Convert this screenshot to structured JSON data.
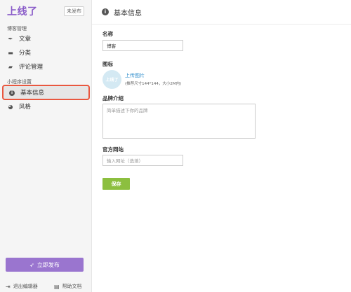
{
  "sidebar": {
    "brand": "上线了",
    "status_badge": "未发布",
    "groups": [
      {
        "title": "博客管理",
        "items": [
          {
            "label": "文章",
            "icon": "pen-icon"
          },
          {
            "label": "分类",
            "icon": "folder-icon"
          },
          {
            "label": "评论管理",
            "icon": "comment-icon"
          }
        ]
      },
      {
        "title": "小程序设置",
        "items": [
          {
            "label": "基本信息",
            "icon": "info-icon",
            "active": true
          },
          {
            "label": "风格",
            "icon": "palette-icon"
          }
        ]
      }
    ],
    "publish_button": "立即发布",
    "footer": {
      "exit_editor": "退出编辑器",
      "help_docs": "帮助文档"
    }
  },
  "main": {
    "title": "基本信息",
    "name_label": "名称",
    "name_value": "博客",
    "icon_label": "图标",
    "logo_text": "上线了",
    "upload_link": "上传图片",
    "upload_hint": "(推荐尺寸144*144，大小2M内)",
    "brand_intro_label": "品牌介绍",
    "brand_intro_placeholder": "简单描述下你的品牌",
    "website_label": "官方网站",
    "website_placeholder": "输入网址（选填）",
    "save_button": "保存"
  },
  "colors": {
    "brand": "#8a5cc9",
    "publish_button": "#9a75cf",
    "save_button": "#8cbf3f",
    "active_outline": "#e9573f",
    "link": "#2d8ccb"
  }
}
